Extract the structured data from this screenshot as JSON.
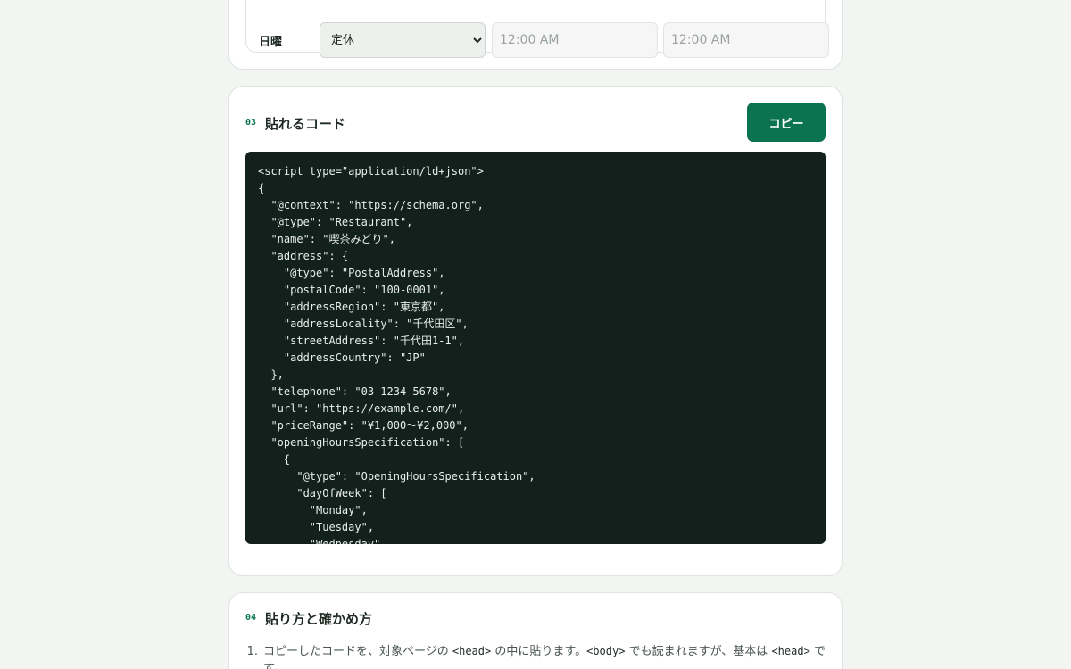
{
  "hours": {
    "day_label": "日曜",
    "status_selected": "定休",
    "open_time": "12:00 AM",
    "close_time": "12:00 AM"
  },
  "code_section": {
    "number": "03",
    "title": "貼れるコード",
    "copy_label": "コピー",
    "code": "<script type=\"application/ld+json\">\n{\n  \"@context\": \"https://schema.org\",\n  \"@type\": \"Restaurant\",\n  \"name\": \"喫茶みどり\",\n  \"address\": {\n    \"@type\": \"PostalAddress\",\n    \"postalCode\": \"100-0001\",\n    \"addressRegion\": \"東京都\",\n    \"addressLocality\": \"千代田区\",\n    \"streetAddress\": \"千代田1-1\",\n    \"addressCountry\": \"JP\"\n  },\n  \"telephone\": \"03-1234-5678\",\n  \"url\": \"https://example.com/\",\n  \"priceRange\": \"¥1,000〜¥2,000\",\n  \"openingHoursSpecification\": [\n    {\n      \"@type\": \"OpeningHoursSpecification\",\n      \"dayOfWeek\": [\n        \"Monday\",\n        \"Tuesday\",\n        \"Wednesday\","
  },
  "how_section": {
    "number": "04",
    "title": "貼り方と確かめ方",
    "steps": [
      {
        "index": "1.",
        "text_a": "コピーしたコードを、対象ページの ",
        "code_a": "<head>",
        "text_b": " の中に貼ります。",
        "code_b": "<body>",
        "text_c": " でも読まれますが、基本は ",
        "code_c": "<head>",
        "text_d": " です。"
      }
    ]
  }
}
